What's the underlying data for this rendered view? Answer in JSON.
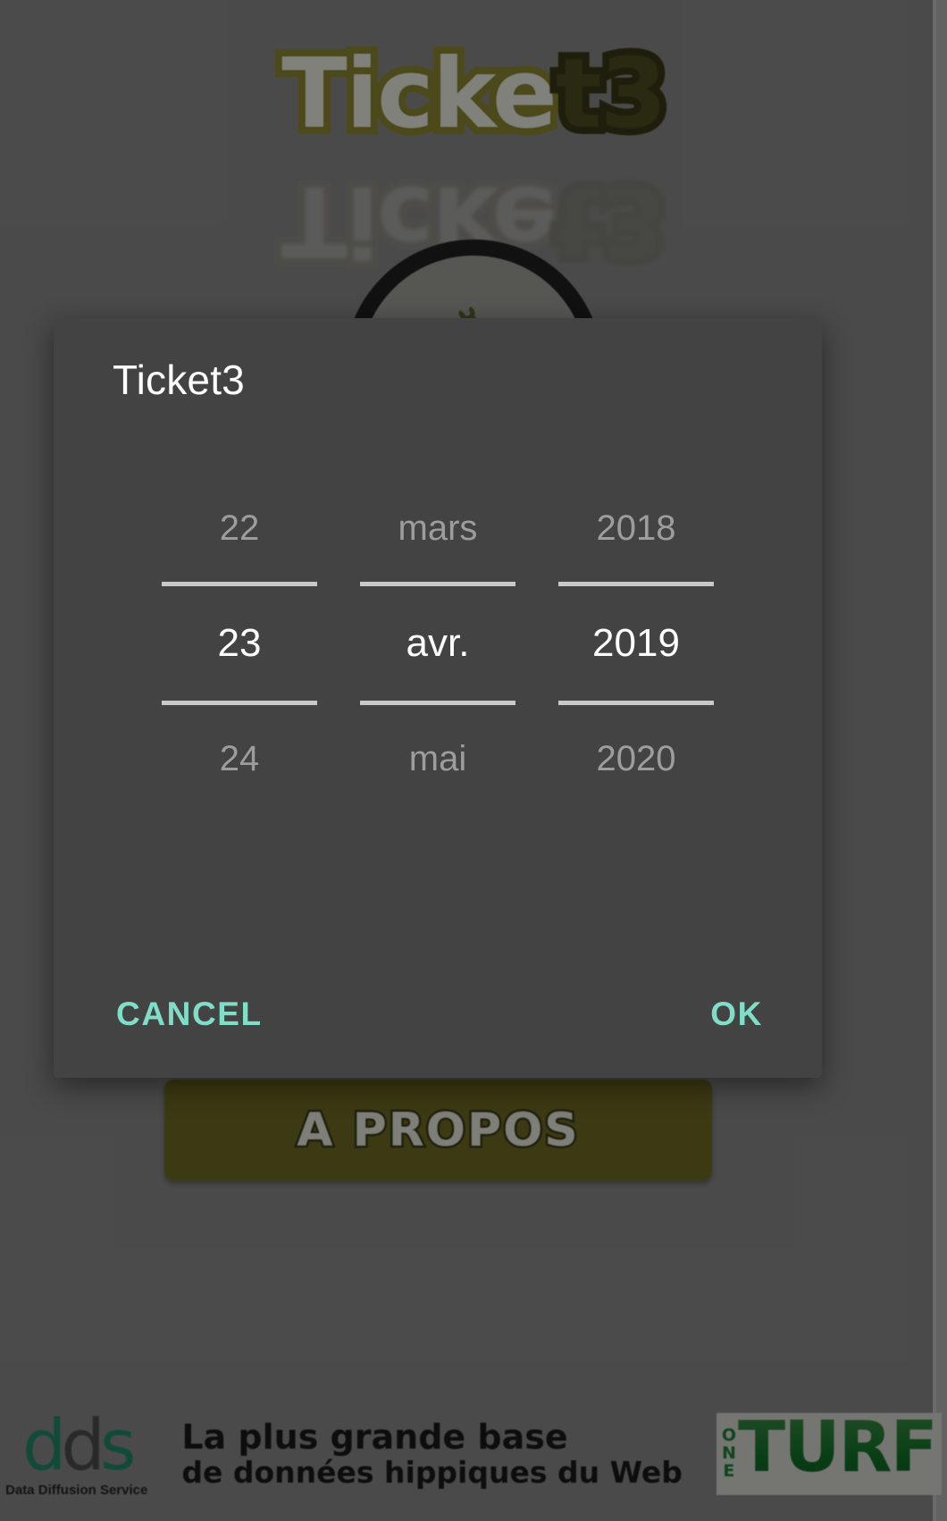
{
  "background_app": {
    "wordmark": {
      "light_part": "Ticke",
      "dark_part": "t3",
      "full": "Ticket3"
    },
    "badge": {
      "icon": "horse-icon",
      "glyph": "♞"
    },
    "about_button_label": "A PROPOS",
    "banner": {
      "dds_logo_left": "d",
      "dds_logo_mid": "d",
      "dds_logo_right": "s",
      "dds_subtitle": "Data Diffusion Service",
      "slogan_line1": "La plus grande base",
      "slogan_line2": "de données hippiques du Web",
      "oneturf_o": "O",
      "oneturf_n": "N",
      "oneturf_e": "E",
      "oneturf_main": "TURF"
    }
  },
  "dialog": {
    "title": "Ticket3",
    "accent_color": "#80DEC8",
    "surface_color": "#434343",
    "picker": {
      "day": {
        "previous": "22",
        "selected": "23",
        "next": "24"
      },
      "month": {
        "previous": "mars",
        "selected": "avr.",
        "next": "mai"
      },
      "year": {
        "previous": "2018",
        "selected": "2019",
        "next": "2020"
      }
    },
    "buttons": {
      "cancel": "CANCEL",
      "ok": "OK"
    }
  }
}
